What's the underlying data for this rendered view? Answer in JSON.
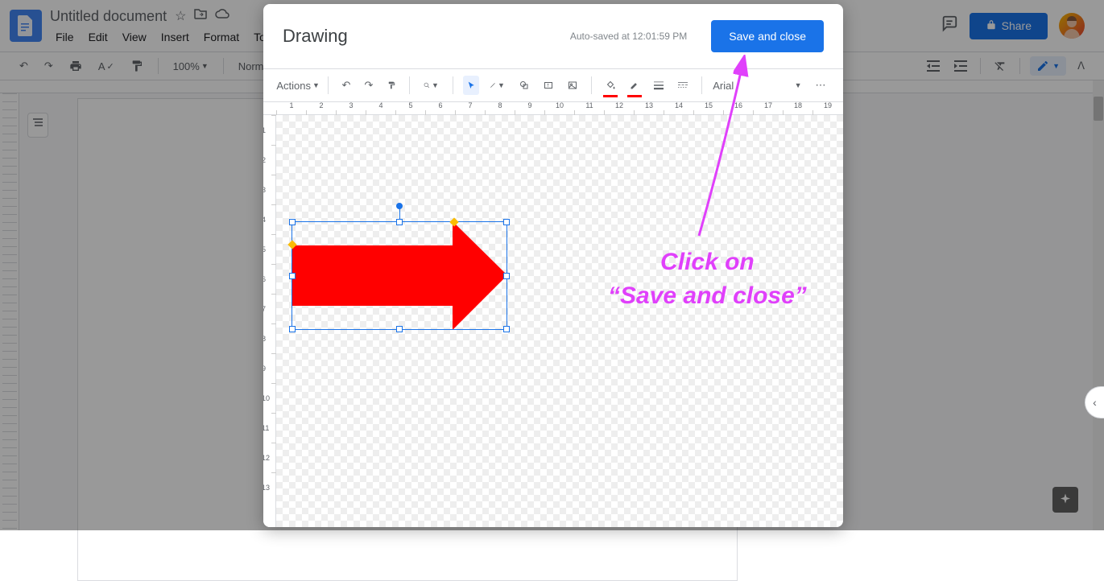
{
  "docs": {
    "title": "Untitled document",
    "menus": [
      "File",
      "Edit",
      "View",
      "Insert",
      "Format",
      "Tools"
    ],
    "zoom": "100%",
    "style": "Normal text",
    "share_label": "Share"
  },
  "modal": {
    "title": "Drawing",
    "status": "Auto-saved at 12:01:59 PM",
    "save_close_label": "Save and close",
    "actions_label": "Actions",
    "font": "Arial"
  },
  "annotation": {
    "line1": "Click on",
    "line2": "“Save and close”"
  },
  "ruler_h": [
    "1",
    "2",
    "3",
    "4",
    "5",
    "6",
    "7",
    "8",
    "9",
    "10",
    "11",
    "12",
    "13",
    "14",
    "15",
    "16",
    "17",
    "18",
    "19"
  ],
  "ruler_v": [
    "1",
    "2",
    "3",
    "4",
    "5",
    "6",
    "7",
    "8",
    "9",
    "10",
    "11",
    "12",
    "13"
  ],
  "colors": {
    "fill": "#ff0000",
    "border": "#000000",
    "accent": "#1a73e8"
  }
}
